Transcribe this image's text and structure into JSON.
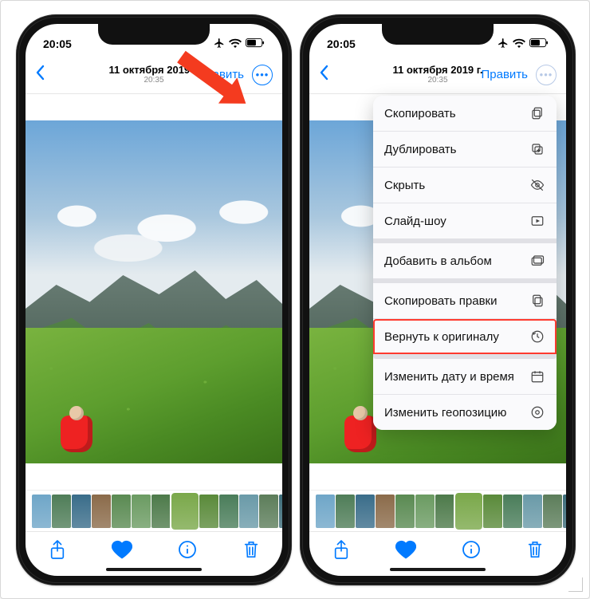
{
  "status": {
    "time": "20:05"
  },
  "nav": {
    "date": "11 октября 2019 г.",
    "time": "20:35",
    "edit": "Править"
  },
  "menu": {
    "copy": "Скопировать",
    "duplicate": "Дублировать",
    "hide": "Скрыть",
    "slideshow": "Слайд-шоу",
    "add_album": "Добавить в альбом",
    "copy_edits": "Скопировать правки",
    "revert": "Вернуть к оригиналу",
    "edit_date": "Изменить дату и время",
    "edit_geo": "Изменить геопозицию"
  },
  "thumbs": [
    "#6fa6c8",
    "#4f7d58",
    "#3a6d8a",
    "#8b6b4a",
    "#5a8a52",
    "#6b9b62",
    "#4d7a4a",
    "#7aa84a",
    "#5a8a3a",
    "#4a7d5a",
    "#6a9aa8",
    "#5c7d5a",
    "#3d6d7a"
  ],
  "sel_thumb": 7
}
